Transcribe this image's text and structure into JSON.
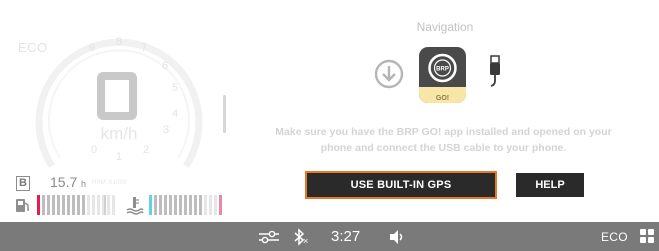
{
  "gauge": {
    "mode_label": "ECO",
    "speed_unit": "km/h",
    "scale_marks": [
      "0",
      "1",
      "2",
      "3",
      "4",
      "5",
      "6",
      "7",
      "8",
      "9"
    ],
    "scale_sub_label": "RPM X1000",
    "fuel_badge": "B",
    "fuel_hours": "15.7",
    "fuel_hours_unit": "h"
  },
  "navigation": {
    "title": "Navigation",
    "app_label": "GO!",
    "message": "Make sure you have the BRP GO! app installed and opened on your phone and connect the USB cable to your phone.",
    "gps_button_label": "USE BUILT-IN GPS",
    "help_button_label": "HELP"
  },
  "status_bar": {
    "clock": "3:27",
    "bluetooth_state": "×",
    "mode": "ECO"
  },
  "colors": {
    "status_bar_bg": "#7a7a7a",
    "button_bg": "#2a2a2a",
    "focus_border": "#e8782a",
    "fuel_low_red": "#e02050",
    "temp_cyan": "#5fd4e8"
  },
  "icons": [
    "settings-toggle-icon",
    "bluetooth-icon",
    "volume-icon",
    "app-grid-icon",
    "download-icon",
    "brp-go-app-icon",
    "usb-cable-icon",
    "fuel-pump-icon",
    "coolant-temp-icon"
  ]
}
